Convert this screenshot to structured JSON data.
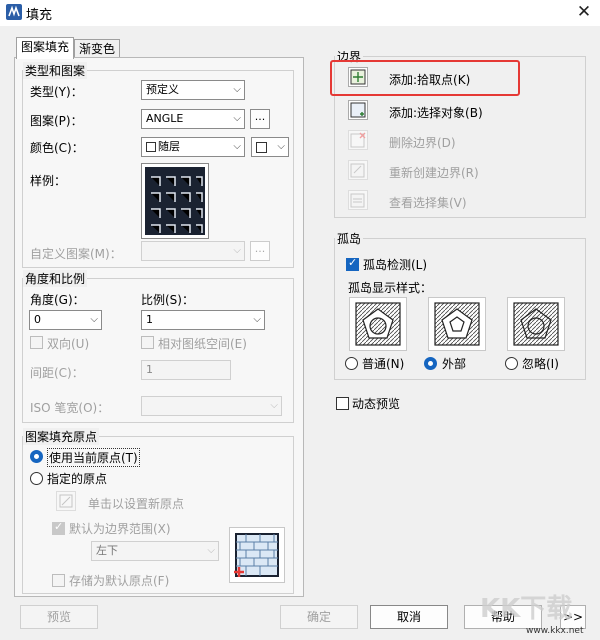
{
  "window": {
    "title": "填充",
    "close": "✕"
  },
  "tabs": [
    "图案填充",
    "渐变色"
  ],
  "type_pattern": {
    "group_label": "类型和图案",
    "type_label": "类型(Y)：",
    "type_value": "预定义",
    "pattern_label": "图案(P)：",
    "pattern_value": "ANGLE",
    "color_label": "颜色(C)：",
    "color_value": "随层",
    "sample_label": "样例：",
    "custom_label": "自定义图案(M)：",
    "ellipsis": "..."
  },
  "angle_scale": {
    "group_label": "角度和比例",
    "angle_label": "角度(G)：",
    "angle_value": "0",
    "scale_label": "比例(S)：",
    "scale_value": "1",
    "double_label": "双向(U)",
    "relative_label": "相对图纸空间(E)",
    "spacing_label": "间距(C)：",
    "spacing_value": "1",
    "iso_label": "ISO 笔宽(O)："
  },
  "origin": {
    "group_label": "图案填充原点",
    "use_current": "使用当前原点(T)",
    "specified": "指定的原点",
    "click_set": "单击以设置新原点",
    "default_boundary": "默认为边界范围(X)",
    "position_value": "左下",
    "store_default": "存储为默认原点(F)"
  },
  "boundary": {
    "group_label": "边界",
    "add_pick": "添加:拾取点(K)",
    "add_select": "添加:选择对象(B)",
    "remove": "删除边界(D)",
    "recreate": "重新创建边界(R)",
    "view_selection": "查看选择集(V)"
  },
  "islands": {
    "group_label": "孤岛",
    "detect_label": "孤岛检测(L)",
    "style_label": "孤岛显示样式：",
    "styles": [
      "普通(N)",
      "外部",
      "忽略(I)"
    ]
  },
  "dynamic_preview": "动态预览",
  "buttons": {
    "preview": "预览",
    "ok": "确定",
    "cancel": "取消",
    "help": "帮助",
    "more": ">>"
  },
  "watermark": {
    "logo": "KK下载",
    "url": "www.kkx.net"
  },
  "colors": {
    "accent": "#1565c0",
    "highlight": "#e53935"
  }
}
